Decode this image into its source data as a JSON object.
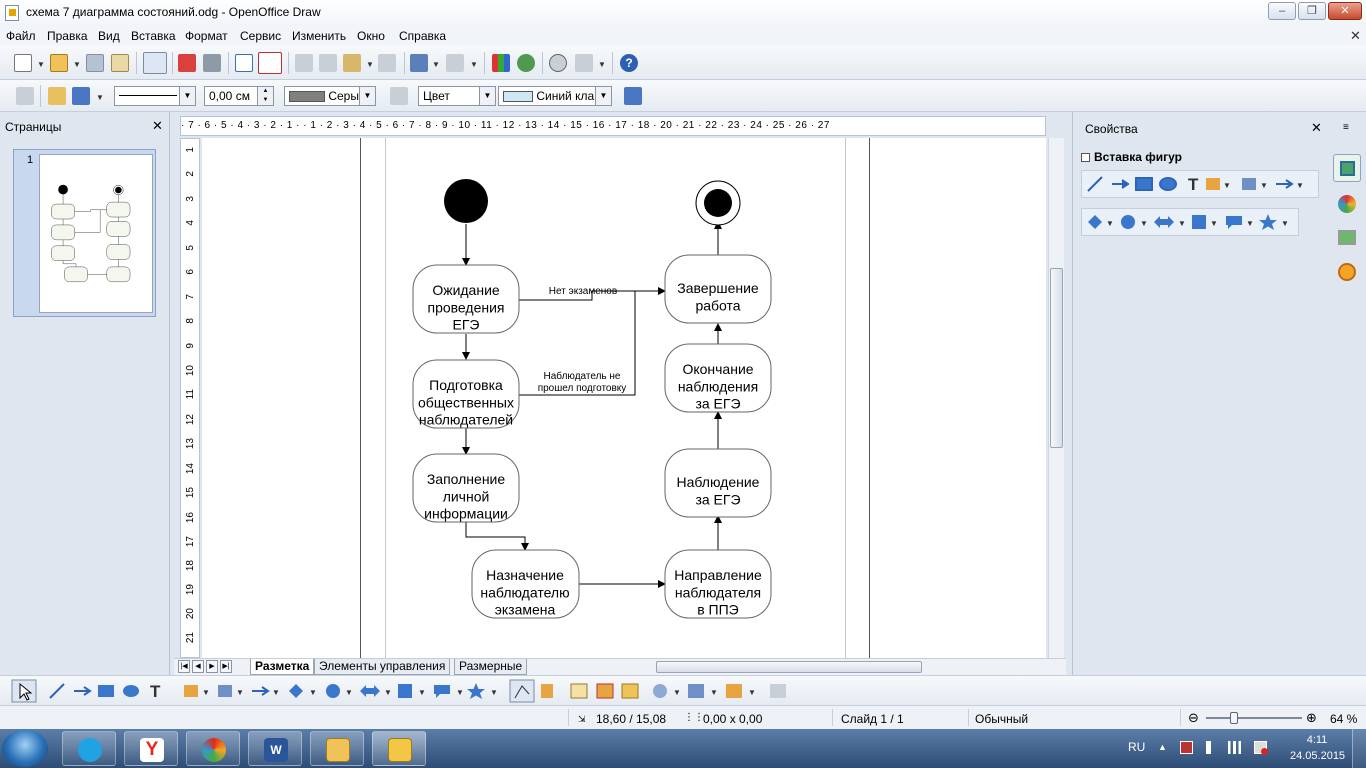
{
  "window": {
    "title": "схема 7 диаграмма состояний.odg - OpenOffice Draw",
    "min": "‒",
    "max": "❐",
    "close": "✕"
  },
  "menu": [
    "Файл",
    "Правка",
    "Вид",
    "Вставка",
    "Формат",
    "Сервис",
    "Изменить",
    "Окно",
    "Справка"
  ],
  "toolbar2": {
    "line_width": "0,00 см",
    "line_color": "Серый",
    "area_style": "Цвет",
    "area_color": "Синий кла"
  },
  "pages_pane": {
    "title": "Страницы",
    "close": "✕",
    "page_number": "1"
  },
  "ruler": {
    "h": "· 7 · 6 · 5 · 4 · 3 · 2 · 1 ·   · 1 · 2 · 3 · 4 · 5 · 6 · 7 · 8 · 9 · 10 · 11 · 12 · 13 · 14 · 15 · 16 · 17 · 18 ·   20 · 21 · 22 · 23 · 24 · 25 · 26 · 27",
    "v": [
      "1",
      "2",
      "3",
      "4",
      "5",
      "6",
      "7",
      "8",
      "9",
      "10",
      "11",
      "12",
      "13",
      "14",
      "15",
      "16",
      "17",
      "18",
      "19",
      "20",
      "21"
    ]
  },
  "diagram": {
    "states": {
      "s1": "Ожидание|проведения|ЕГЭ",
      "s2": "Подготовка|общественных|наблюдателей",
      "s3": "Заполнение|личной|информации",
      "s4": "Назначение|наблюдателю|экзамена",
      "s5": "Направление|наблюдателя|в ППЭ",
      "s6": "Наблюдение|за ЕГЭ",
      "s7": "Окончание|наблюдения|за ЕГЭ",
      "s8": "Завершение|работа"
    },
    "labels": {
      "no_exams": "Нет экзаменов",
      "not_trained": "Наблюдатель не|прошел подготовку"
    }
  },
  "layer_tabs": [
    "Разметка",
    "Элементы управления",
    "Размерные"
  ],
  "sidebar": {
    "title": "Свойства",
    "close": "✕",
    "menu": "≡",
    "section": "Вставка фигур"
  },
  "status": {
    "position": "18,60 / 15,08",
    "size": "0,00 x 0,00",
    "slide": "Слайд 1 / 1",
    "layout": "Обычный",
    "zoom": "64 %"
  },
  "taskbar": {
    "lang": "RU",
    "time": "4:11",
    "date": "24.05.2015"
  }
}
